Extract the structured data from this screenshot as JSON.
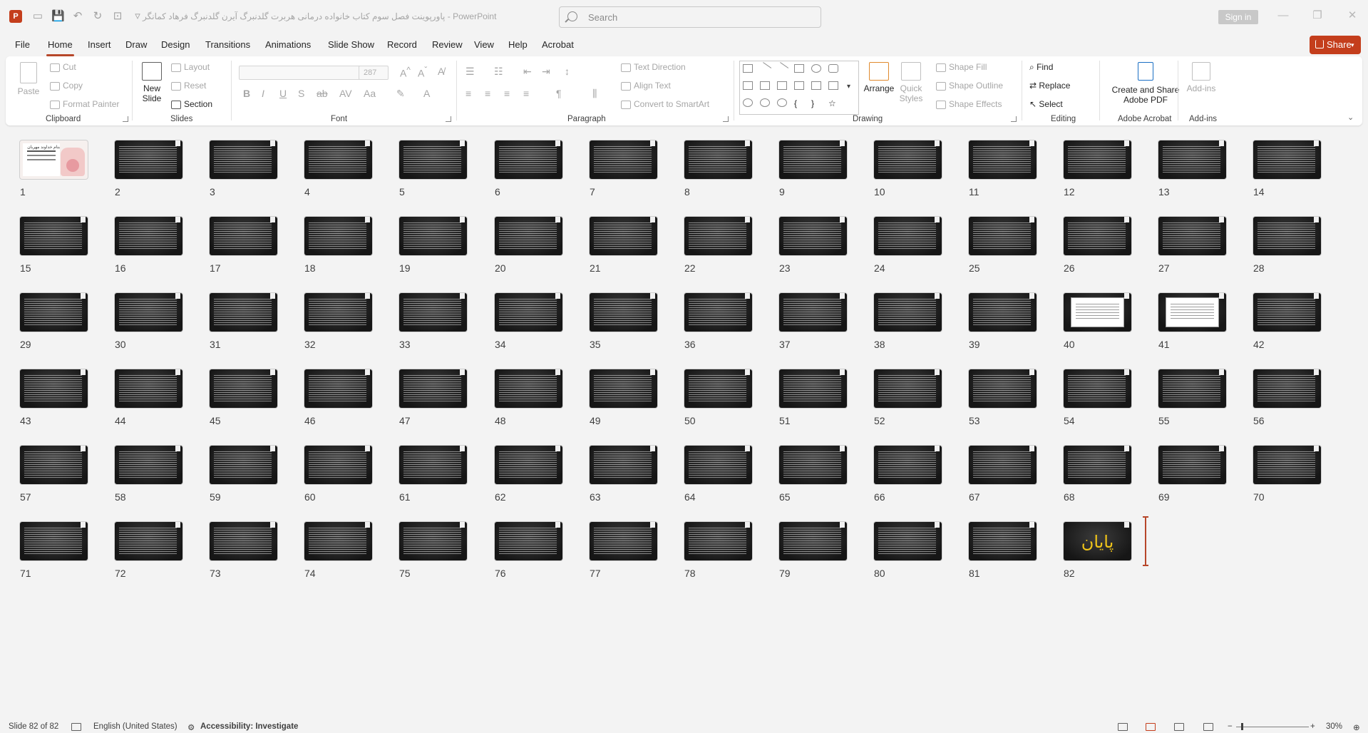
{
  "app": {
    "logo": "P",
    "title": "پاورپوینت فصل سوم کتاب خانواده درمانی هربرت گلدنبرگ آیرن گلدنبرگ فرهاد کمانگر  -  PowerPoint",
    "search_placeholder": "Search",
    "sign_in": "Sign in"
  },
  "tabs": [
    "File",
    "Home",
    "Insert",
    "Draw",
    "Design",
    "Transitions",
    "Animations",
    "Slide Show",
    "Record",
    "Review",
    "View",
    "Help",
    "Acrobat"
  ],
  "active_tab": "Home",
  "share_label": "Share",
  "ribbon": {
    "clipboard": {
      "label": "Clipboard",
      "paste": "Paste",
      "cut": "Cut",
      "copy": "Copy",
      "format_painter": "Format Painter"
    },
    "slides": {
      "label": "Slides",
      "new_slide": "New Slide",
      "layout": "Layout",
      "reset": "Reset",
      "section": "Section"
    },
    "font": {
      "label": "Font",
      "font_size": "287"
    },
    "paragraph": {
      "label": "Paragraph",
      "text_direction": "Text Direction",
      "align_text": "Align Text",
      "convert_smartart": "Convert to SmartArt"
    },
    "drawing": {
      "label": "Drawing",
      "arrange": "Arrange",
      "quick_styles": "Quick Styles",
      "shape_fill": "Shape Fill",
      "shape_outline": "Shape Outline",
      "shape_effects": "Shape Effects"
    },
    "editing": {
      "label": "Editing",
      "find": "Find",
      "replace": "Replace",
      "select": "Select"
    },
    "acrobat": {
      "label": "Adobe Acrobat",
      "create_share": "Create and Share Adobe PDF"
    },
    "addins": {
      "label": "Add-ins",
      "addins": "Add-ins"
    }
  },
  "slides": {
    "count": 82,
    "title_slide_text": "بنام خداوند مهربان",
    "end_slide_text": "پایان",
    "light_slides": [
      40,
      41
    ],
    "selected_slide": 82
  },
  "status": {
    "slide_of": "Slide 82 of 82",
    "language": "English (United States)",
    "accessibility": "Accessibility: Investigate",
    "zoom": "30%"
  },
  "colors": {
    "accent": "#c43e1c",
    "tab_underline": "#b7472a",
    "end_text": "#f0c419"
  }
}
